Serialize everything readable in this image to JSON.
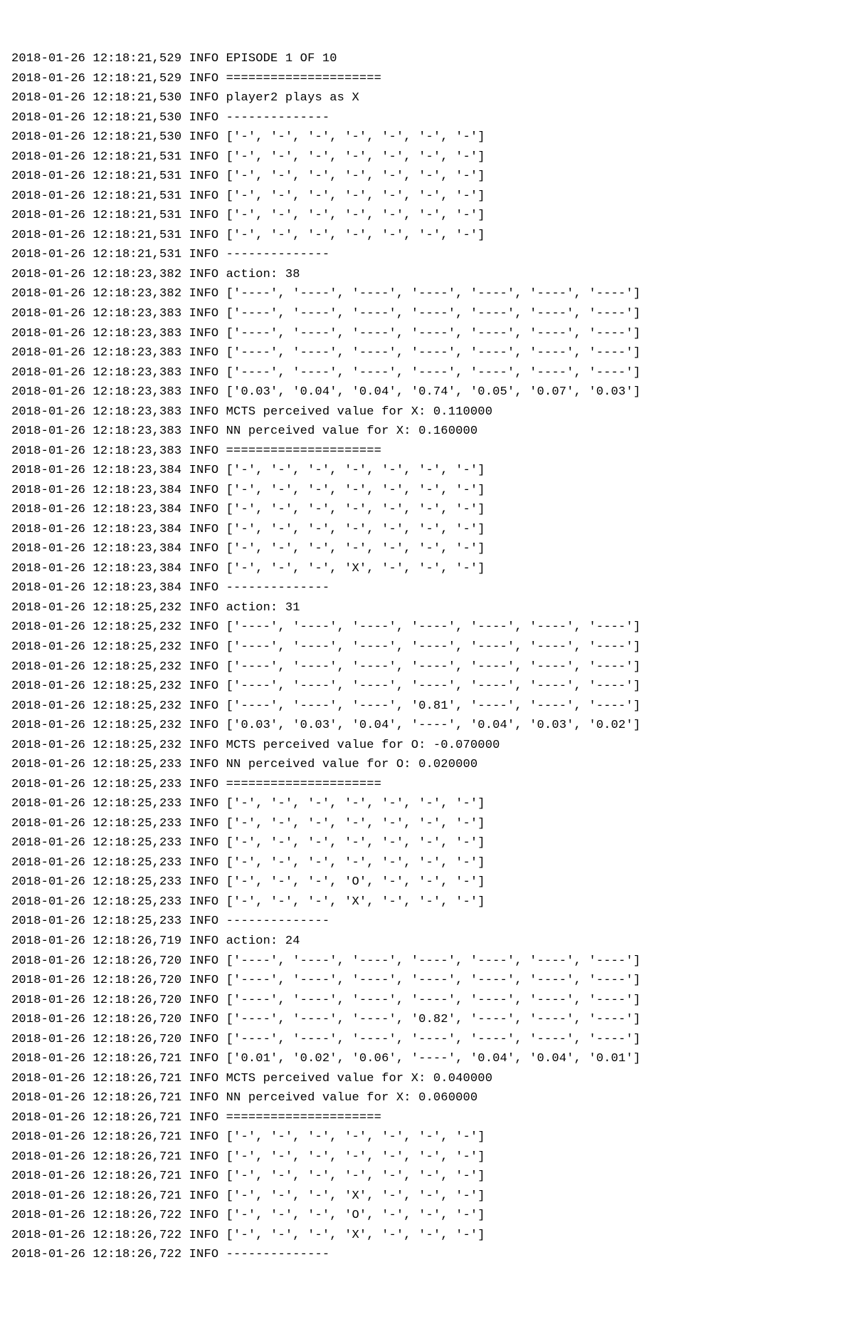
{
  "date": "2018-01-26",
  "level": "INFO",
  "dash7": "['-', '-', '-', '-', '-', '-', '-']",
  "dash4x7": "['----', '----', '----', '----', '----', '----', '----']",
  "hr_eq": "=====================",
  "hr_dash": "--------------",
  "header": {
    "ts": "12:18:21,529",
    "episode": "EPISODE 1 OF 10",
    "ts2": "12:18:21,530",
    "plays": "player2 plays as X",
    "board_ts": [
      "12:18:21,530",
      "12:18:21,531",
      "12:18:21,531",
      "12:18:21,531",
      "12:18:21,531",
      "12:18:21,531"
    ],
    "hr_ts": "12:18:21,531"
  },
  "move1": {
    "ts_action": "12:18:23,382",
    "action": "action: 38",
    "probs_ts": [
      "12:18:23,382",
      "12:18:23,383",
      "12:18:23,383",
      "12:18:23,383",
      "12:18:23,383"
    ],
    "probs_last_ts": "12:18:23,383",
    "probs_last": "['0.03', '0.04', '0.04', '0.74', '0.05', '0.07', '0.03']",
    "mcts_ts": "12:18:23,383",
    "mcts": "MCTS perceived value for X: 0.110000",
    "nn_ts": "12:18:23,383",
    "nn": "NN perceived value for X: 0.160000",
    "hr_eq_ts": "12:18:23,383",
    "board_ts": [
      "12:18:23,384",
      "12:18:23,384",
      "12:18:23,384",
      "12:18:23,384",
      "12:18:23,384",
      "12:18:23,384"
    ],
    "board_last": "['-', '-', '-', 'X', '-', '-', '-']",
    "hr_dash_ts": "12:18:23,384"
  },
  "move2": {
    "ts_action": "12:18:25,232",
    "action": "action: 31",
    "probs_ts": [
      "12:18:25,232",
      "12:18:25,232",
      "12:18:25,232",
      "12:18:25,232"
    ],
    "probs_row5_ts": "12:18:25,232",
    "probs_row5": "['----', '----', '----', '0.81', '----', '----', '----']",
    "probs_last_ts": "12:18:25,232",
    "probs_last": "['0.03', '0.03', '0.04', '----', '0.04', '0.03', '0.02']",
    "mcts_ts": "12:18:25,232",
    "mcts": "MCTS perceived value for O: -0.070000",
    "nn_ts": "12:18:25,233",
    "nn": "NN perceived value for O: 0.020000",
    "hr_eq_ts": "12:18:25,233",
    "board_ts": [
      "12:18:25,233",
      "12:18:25,233",
      "12:18:25,233",
      "12:18:25,233"
    ],
    "board_row5_ts": "12:18:25,233",
    "board_row5": "['-', '-', '-', 'O', '-', '-', '-']",
    "board_row6_ts": "12:18:25,233",
    "board_row6": "['-', '-', '-', 'X', '-', '-', '-']",
    "hr_dash_ts": "12:18:25,233"
  },
  "move3": {
    "ts_action": "12:18:26,719",
    "action": "action: 24",
    "probs_ts": [
      "12:18:26,720",
      "12:18:26,720",
      "12:18:26,720"
    ],
    "probs_row4_ts": "12:18:26,720",
    "probs_row4": "['----', '----', '----', '0.82', '----', '----', '----']",
    "probs_row5_ts": "12:18:26,720",
    "probs_last_ts": "12:18:26,721",
    "probs_last": "['0.01', '0.02', '0.06', '----', '0.04', '0.04', '0.01']",
    "mcts_ts": "12:18:26,721",
    "mcts": "MCTS perceived value for X: 0.040000",
    "nn_ts": "12:18:26,721",
    "nn": "NN perceived value for X: 0.060000",
    "hr_eq_ts": "12:18:26,721",
    "board_ts": [
      "12:18:26,721",
      "12:18:26,721",
      "12:18:26,721"
    ],
    "board_row4_ts": "12:18:26,721",
    "board_row4": "['-', '-', '-', 'X', '-', '-', '-']",
    "board_row5_ts": "12:18:26,722",
    "board_row5": "['-', '-', '-', 'O', '-', '-', '-']",
    "board_row6_ts": "12:18:26,722",
    "board_row6": "['-', '-', '-', 'X', '-', '-', '-']",
    "hr_dash_ts_partial": "12:18:26,722",
    "partial_date": "2018-01-26"
  }
}
